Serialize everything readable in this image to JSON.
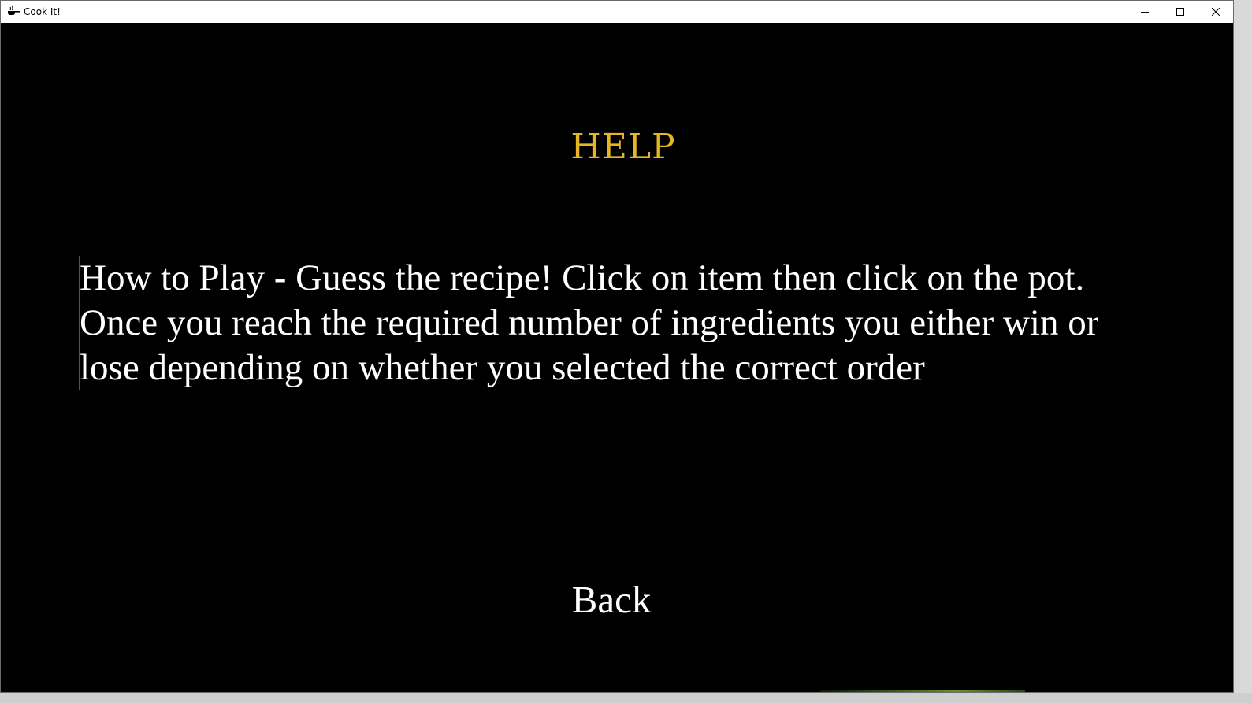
{
  "window": {
    "title": "Cook It!",
    "app_icon": "frying-pan-icon",
    "controls": {
      "minimize_icon": "minimize-icon",
      "maximize_icon": "maximize-icon",
      "close_icon": "close-icon"
    }
  },
  "screen": {
    "heading": "HELP",
    "help_text": "How to Play - Guess the recipe! Click on item then click on the pot. Once you reach the required number of ingredients you either win or lose depending on whether you selected the correct order",
    "back_label": "Back"
  },
  "colors": {
    "background": "#000000",
    "heading": "#e7b523",
    "text": "#ffffff"
  }
}
